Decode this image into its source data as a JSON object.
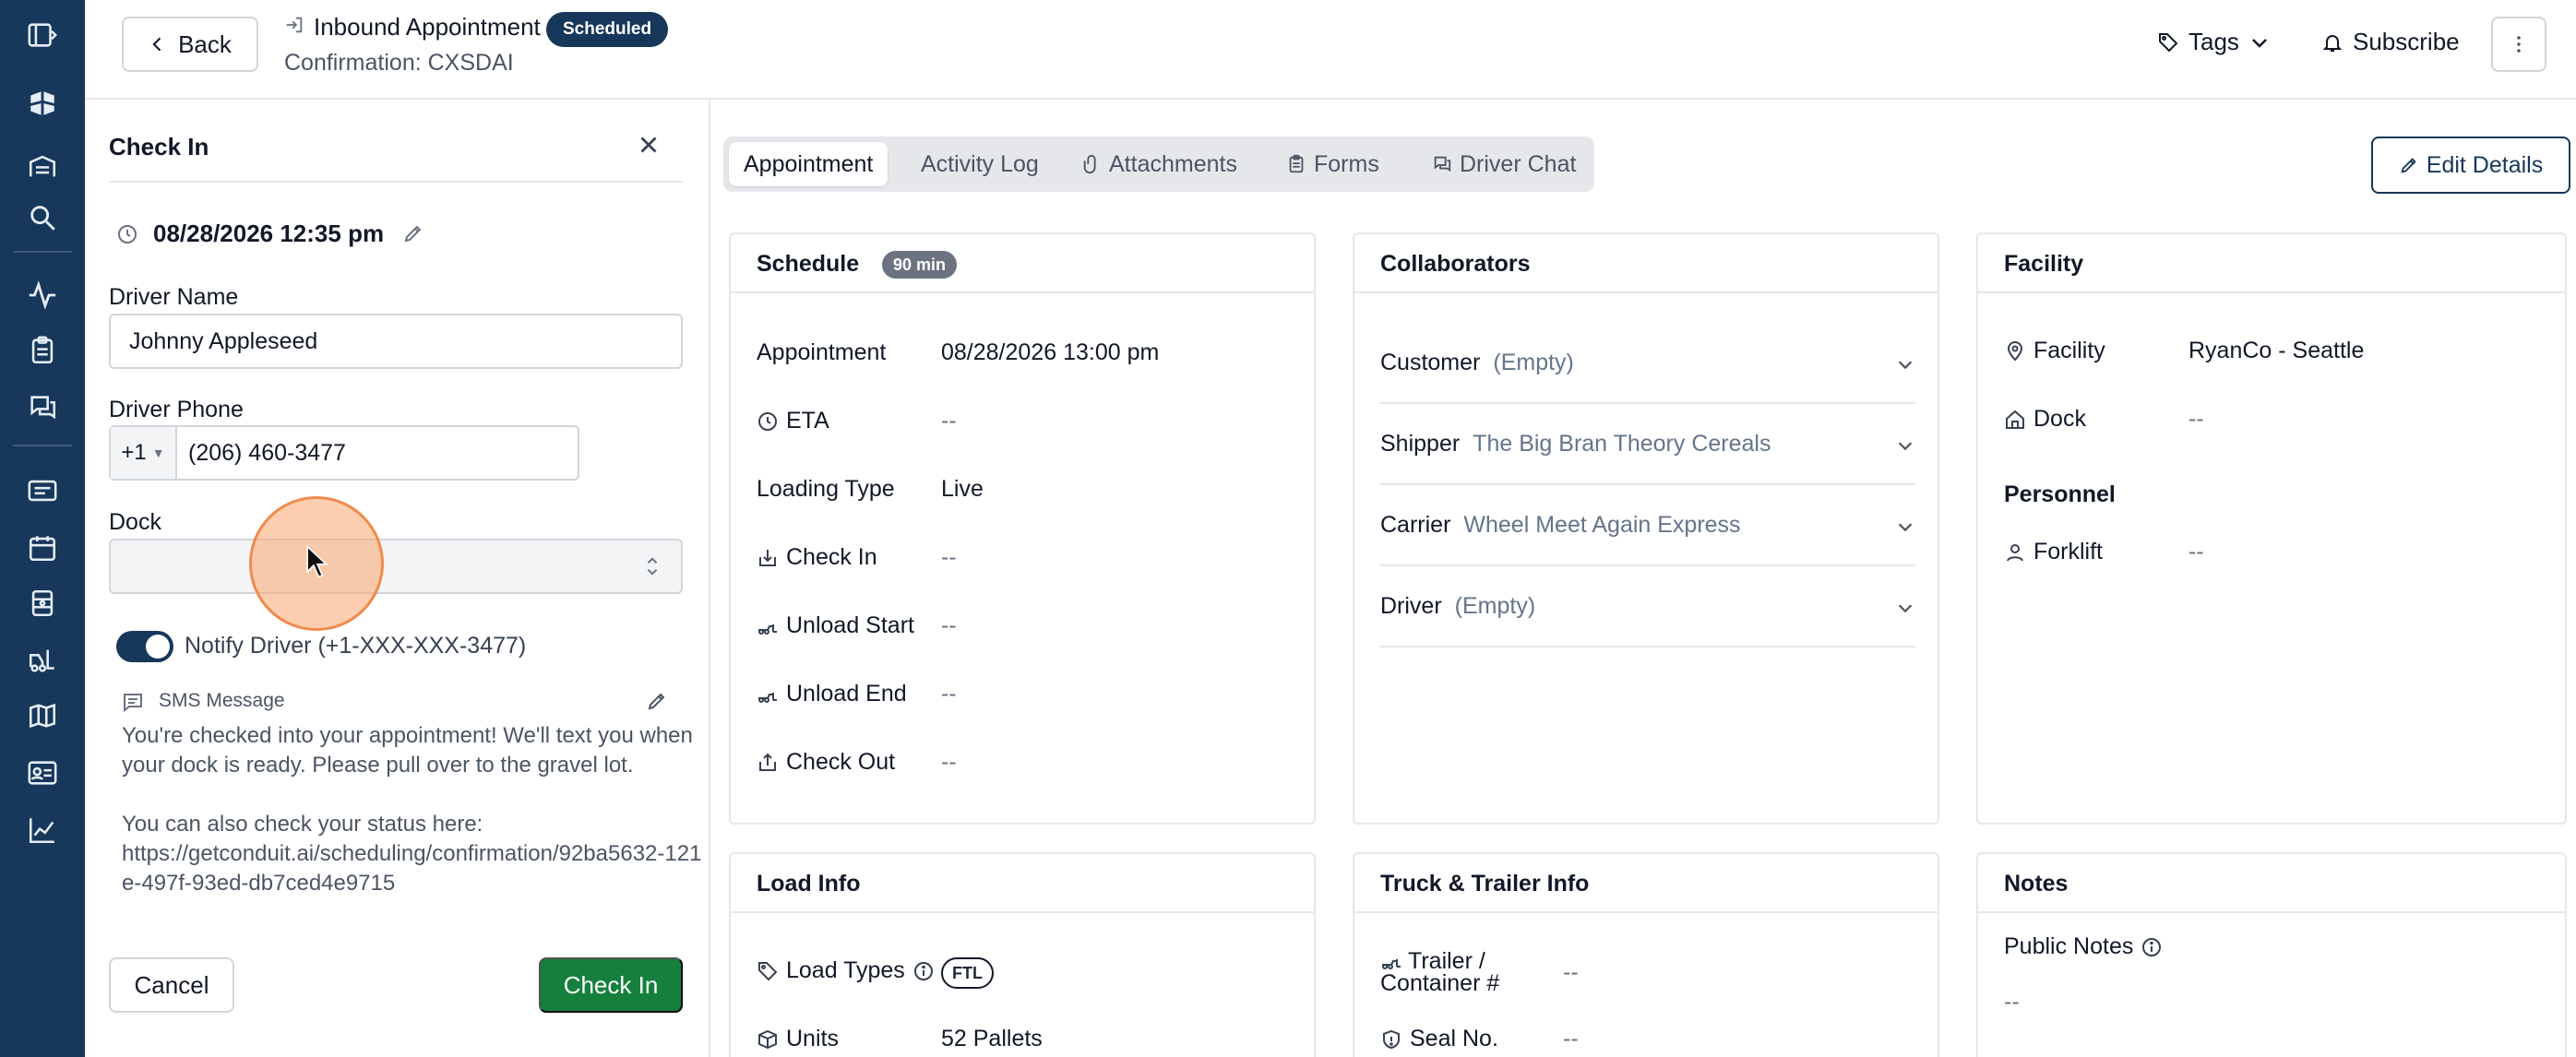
{
  "header": {
    "back_label": "Back",
    "appointment_title": "Inbound Appointment",
    "status": "Scheduled",
    "confirmation": "Confirmation: CXSDAI",
    "tags_label": "Tags",
    "subscribe_label": "Subscribe"
  },
  "check_in_panel": {
    "title": "Check In",
    "datetime": "08/28/2026 12:35 pm",
    "driver_name_label": "Driver Name",
    "driver_name_value": "Johnny Appleseed",
    "driver_phone_label": "Driver Phone",
    "phone_country_code": "+1",
    "phone_number": "(206) 460-3477",
    "dock_label": "Dock",
    "dock_value": "",
    "notify_label": "Notify Driver (+1-XXX-XXX-3477)",
    "notify_enabled": true,
    "sms_label": "SMS Message",
    "sms_line1": "You're checked into your appointment! We'll text you when your dock is ready. Please pull over to the gravel lot.",
    "sms_line2": "You can also check your status here:",
    "sms_link": "https://getconduit.ai/scheduling/confirmation/92ba5632-121e-497f-93ed-db7ced4e9715",
    "cancel_label": "Cancel",
    "submit_label": "Check In"
  },
  "tabs": [
    {
      "label": "Appointment",
      "icon": "",
      "active": true
    },
    {
      "label": "Activity Log",
      "icon": "",
      "active": false
    },
    {
      "label": "Attachments",
      "icon": "paperclip-icon",
      "active": false
    },
    {
      "label": "Forms",
      "icon": "clipboard-icon",
      "active": false
    },
    {
      "label": "Driver Chat",
      "icon": "chat-icon",
      "active": false
    }
  ],
  "edit_details_label": "Edit Details",
  "schedule": {
    "title": "Schedule",
    "duration": "90 min",
    "rows": [
      {
        "label": "Appointment",
        "value": "08/28/2026 13:00 pm"
      },
      {
        "label": "ETA",
        "value": "--"
      },
      {
        "label": "Loading Type",
        "value": "Live"
      },
      {
        "label": "Check In",
        "value": "--"
      },
      {
        "label": "Unload Start",
        "value": "--"
      },
      {
        "label": "Unload End",
        "value": "--"
      },
      {
        "label": "Check Out",
        "value": "--"
      }
    ]
  },
  "collaborators": {
    "title": "Collaborators",
    "rows": [
      {
        "key": "Customer",
        "value": "(Empty)"
      },
      {
        "key": "Shipper",
        "value": "The Big Bran Theory Cereals"
      },
      {
        "key": "Carrier",
        "value": "Wheel Meet Again Express"
      },
      {
        "key": "Driver",
        "value": "(Empty)"
      }
    ]
  },
  "facility": {
    "title": "Facility",
    "facility_label": "Facility",
    "facility_value": "RyanCo - Seattle",
    "dock_label": "Dock",
    "dock_value": "--",
    "personnel_title": "Personnel",
    "forklift_label": "Forklift",
    "forklift_value": "--"
  },
  "load_info": {
    "title": "Load Info",
    "load_types_label": "Load Types",
    "load_types_value": "FTL",
    "units_label": "Units",
    "units_value": "52 Pallets"
  },
  "truck_trailer": {
    "title": "Truck & Trailer Info",
    "trailer_label_1": "Trailer /",
    "trailer_label_2": "Container #",
    "trailer_value": "--",
    "seal_label": "Seal No.",
    "seal_value": "--"
  },
  "notes": {
    "title": "Notes",
    "public_label": "Public Notes",
    "public_value": "--"
  }
}
